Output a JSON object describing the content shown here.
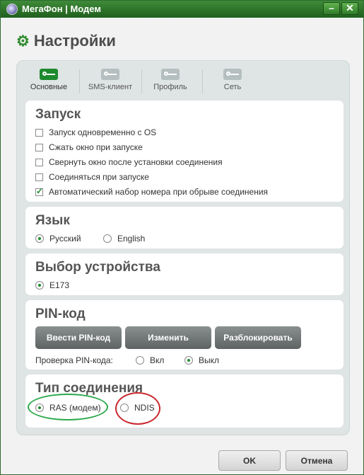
{
  "window": {
    "title": "МегаФон | Модем",
    "minimize": "–",
    "close": "✕"
  },
  "settings": {
    "title": "Настройки"
  },
  "tabs": [
    {
      "label": "Основные",
      "icon": "settings-folder-icon",
      "active": true
    },
    {
      "label": "SMS-клиент",
      "icon": "sms-key-icon",
      "active": false
    },
    {
      "label": "Профиль",
      "icon": "profile-key-icon",
      "active": false
    },
    {
      "label": "Сеть",
      "icon": "network-key-icon",
      "active": false
    }
  ],
  "launch": {
    "title": "Запуск",
    "options": [
      {
        "label": "Запуск одновременно с OS",
        "checked": false
      },
      {
        "label": "Сжать окно при запуске",
        "checked": false
      },
      {
        "label": "Свернуть окно после установки соединения",
        "checked": false
      },
      {
        "label": "Соединяться при запуске",
        "checked": false
      },
      {
        "label": "Автоматический набор номера при обрыве соединения",
        "checked": true
      }
    ]
  },
  "language": {
    "title": "Язык",
    "options": [
      {
        "label": "Русский",
        "selected": true
      },
      {
        "label": "English",
        "selected": false
      }
    ]
  },
  "device": {
    "title": "Выбор устройства",
    "options": [
      {
        "label": "E173",
        "selected": true
      }
    ]
  },
  "pin": {
    "title": "PIN-код",
    "buttons": {
      "enter": "Ввести PIN-код",
      "change": "Изменить",
      "unlock": "Разблокировать"
    },
    "check_label": "Проверка PIN-кода:",
    "check_options": [
      {
        "label": "Вкл",
        "selected": false
      },
      {
        "label": "Выкл",
        "selected": true
      }
    ]
  },
  "connection": {
    "title": "Тип соединения",
    "options": [
      {
        "label": "RAS (модем)",
        "selected": true
      },
      {
        "label": "NDIS",
        "selected": false
      }
    ]
  },
  "footer": {
    "ok": "OK",
    "cancel": "Отмена"
  },
  "colors": {
    "accent": "#1e8a2e",
    "titlebar": "#2f7b2a",
    "annotation_green": "#2aa84a",
    "annotation_red": "#c8282e"
  }
}
